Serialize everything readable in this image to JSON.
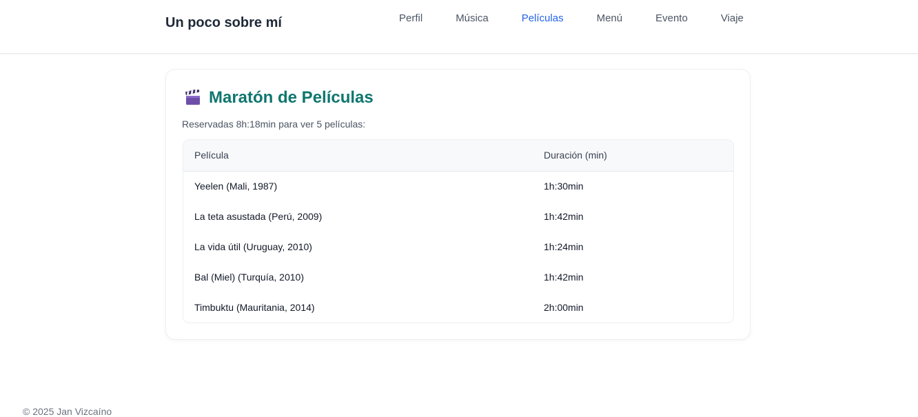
{
  "header": {
    "site_title": "Un poco sobre mí",
    "nav": [
      {
        "label": "Perfil",
        "active": false
      },
      {
        "label": "Música",
        "active": false
      },
      {
        "label": "Películas",
        "active": true
      },
      {
        "label": "Menú",
        "active": false
      },
      {
        "label": "Evento",
        "active": false
      },
      {
        "label": "Viaje",
        "active": false
      }
    ]
  },
  "main": {
    "title_icon": "clapperboard-icon",
    "title": "Maratón de Películas",
    "intro": "Reservadas 8h:18min para ver 5 películas:",
    "table": {
      "columns": [
        "Película",
        "Duración (min)"
      ],
      "rows": [
        [
          "Yeelen (Mali, 1987)",
          "1h:30min"
        ],
        [
          "La teta asustada (Perú, 2009)",
          "1h:42min"
        ],
        [
          "La vida útil (Uruguay, 2010)",
          "1h:24min"
        ],
        [
          "Bal (Miel) (Turquía, 2010)",
          "1h:42min"
        ],
        [
          "Timbuktu (Mauritania, 2014)",
          "2h:00min"
        ]
      ]
    }
  },
  "footer": {
    "text": "© 2025 Jan Vizcaíno"
  },
  "colors": {
    "accent": "#2563eb",
    "title": "#0f766e"
  }
}
